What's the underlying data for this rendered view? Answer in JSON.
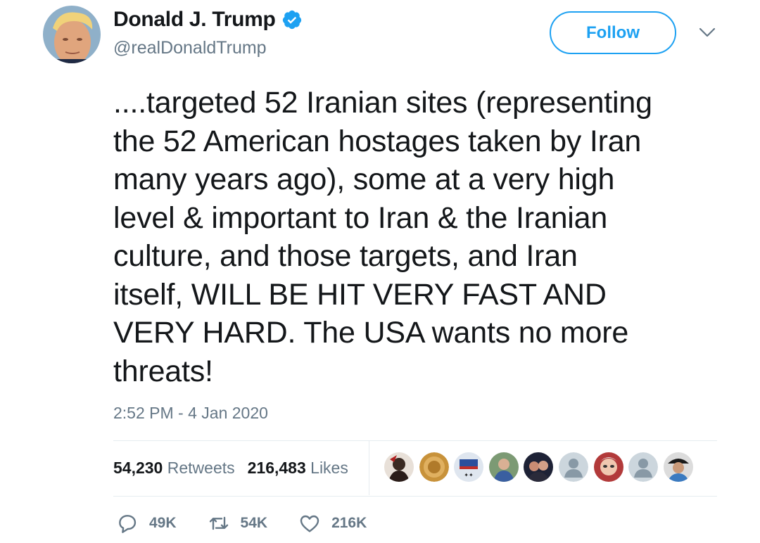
{
  "author": {
    "name": "Donald J. Trump",
    "handle": "@realDonaldTrump",
    "verified_color": "#1da1f2"
  },
  "follow_label": "Follow",
  "tweet_text": "....targeted 52 Iranian sites (representing\nthe 52 American hostages taken by Iran\nmany years ago), some at a very high\nlevel & important to Iran &  the Iranian\nculture, and those targets, and Iran\nitself, WILL BE HIT VERY FAST AND\nVERY HARD. The USA wants no more\nthreats!",
  "timestamp": "2:52 PM - 4 Jan 2020",
  "stats": {
    "retweets_count": "54,230",
    "retweets_label": "Retweets",
    "likes_count": "216,483",
    "likes_label": "Likes"
  },
  "liker_avatars": [
    "liker-avatar-1",
    "liker-avatar-2",
    "liker-avatar-3",
    "liker-avatar-4",
    "liker-avatar-5",
    "liker-avatar-6",
    "liker-avatar-7",
    "liker-avatar-8",
    "liker-avatar-9"
  ],
  "actions": {
    "reply_count": "49K",
    "retweet_count": "54K",
    "like_count": "216K"
  },
  "colors": {
    "accent": "#1da1f2",
    "muted": "#657786",
    "text": "#14171a"
  }
}
